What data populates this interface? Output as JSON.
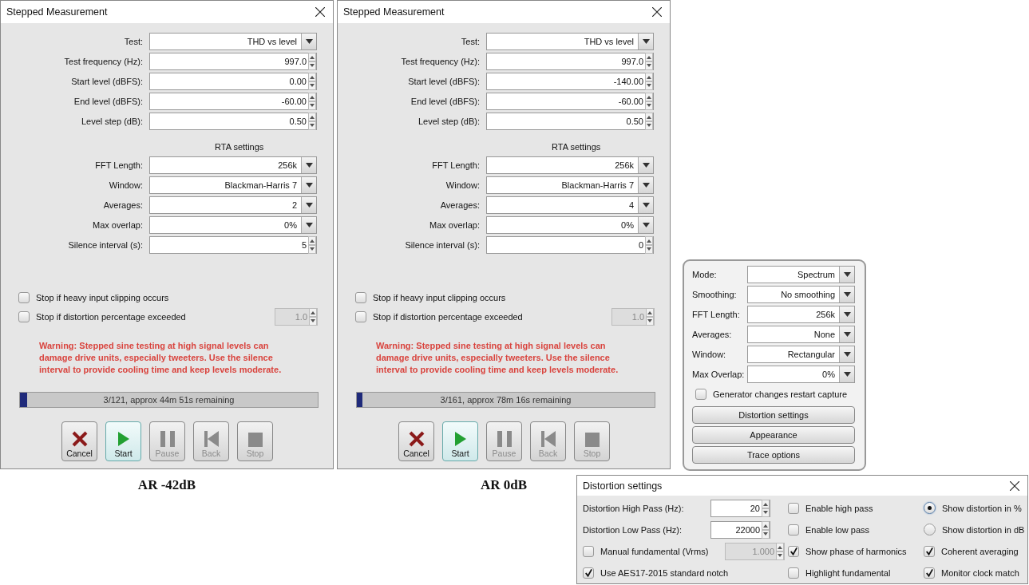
{
  "dialogs": [
    {
      "title": "Stepped Measurement",
      "fields": [
        {
          "label": "Test:",
          "value": "THD vs level",
          "kind": "dropdown"
        },
        {
          "label": "Test frequency (Hz):",
          "value": "997.0",
          "kind": "spin"
        },
        {
          "label": "Start level (dBFS):",
          "value": "0.00",
          "kind": "spin"
        },
        {
          "label": "End level (dBFS):",
          "value": "-60.00",
          "kind": "spin"
        },
        {
          "label": "Level step (dB):",
          "value": "0.50",
          "kind": "spin"
        }
      ],
      "rta_heading": "RTA settings",
      "rta_fields": [
        {
          "label": "FFT Length:",
          "value": "256k",
          "kind": "dropdown"
        },
        {
          "label": "Window:",
          "value": "Blackman-Harris 7",
          "kind": "dropdown"
        },
        {
          "label": "Averages:",
          "value": "2",
          "kind": "dropdown"
        },
        {
          "label": "Max overlap:",
          "value": "0%",
          "kind": "dropdown"
        },
        {
          "label": "Silence interval (s):",
          "value": "5",
          "kind": "spin"
        }
      ],
      "checks": [
        {
          "label": "Stop if heavy input clipping occurs",
          "checked": false
        },
        {
          "label": "Stop if distortion percentage exceeded",
          "checked": false,
          "field": {
            "value": "1.0",
            "disabled": true
          }
        }
      ],
      "warning": "Warning: Stepped sine testing at high signal levels can damage drive units, especially tweeters. Use the silence interval to provide cooling time and keep levels moderate.",
      "progress": {
        "level": 0.025,
        "text": "3/121, approx 44m 51s remaining"
      },
      "buttons": [
        {
          "label": "Cancel",
          "kind": "cancel",
          "disabled": false,
          "focused": false
        },
        {
          "label": "Start",
          "kind": "start",
          "disabled": false,
          "focused": true
        },
        {
          "label": "Pause",
          "kind": "pause",
          "disabled": true,
          "focused": false
        },
        {
          "label": "Back",
          "kind": "back",
          "disabled": true,
          "focused": false
        },
        {
          "label": "Stop",
          "kind": "stop",
          "disabled": true,
          "focused": false
        }
      ],
      "caption": "AR -42dB"
    },
    {
      "title": "Stepped Measurement",
      "fields": [
        {
          "label": "Test:",
          "value": "THD vs level",
          "kind": "dropdown"
        },
        {
          "label": "Test frequency (Hz):",
          "value": "997.0",
          "kind": "spin"
        },
        {
          "label": "Start level (dBFS):",
          "value": "-140.00",
          "kind": "spin"
        },
        {
          "label": "End level (dBFS):",
          "value": "-60.00",
          "kind": "spin"
        },
        {
          "label": "Level step (dB):",
          "value": "0.50",
          "kind": "spin"
        }
      ],
      "rta_heading": "RTA settings",
      "rta_fields": [
        {
          "label": "FFT Length:",
          "value": "256k",
          "kind": "dropdown"
        },
        {
          "label": "Window:",
          "value": "Blackman-Harris 7",
          "kind": "dropdown"
        },
        {
          "label": "Averages:",
          "value": "4",
          "kind": "dropdown"
        },
        {
          "label": "Max overlap:",
          "value": "0%",
          "kind": "dropdown"
        },
        {
          "label": "Silence interval (s):",
          "value": "0",
          "kind": "spin"
        }
      ],
      "checks": [
        {
          "label": "Stop if heavy input clipping occurs",
          "checked": false
        },
        {
          "label": "Stop if distortion percentage exceeded",
          "checked": false,
          "field": {
            "value": "1.0",
            "disabled": true
          }
        }
      ],
      "warning": "Warning: Stepped sine testing at high signal levels can damage drive units, especially tweeters. Use the silence interval to provide cooling time and keep levels moderate.",
      "progress": {
        "level": 0.02,
        "text": "3/161, approx 78m 16s remaining"
      },
      "buttons": [
        {
          "label": "Cancel",
          "kind": "cancel",
          "disabled": false,
          "focused": false
        },
        {
          "label": "Start",
          "kind": "start",
          "disabled": false,
          "focused": true
        },
        {
          "label": "Pause",
          "kind": "pause",
          "disabled": true,
          "focused": false
        },
        {
          "label": "Back",
          "kind": "back",
          "disabled": true,
          "focused": false
        },
        {
          "label": "Stop",
          "kind": "stop",
          "disabled": true,
          "focused": false
        }
      ],
      "caption": "AR 0dB"
    }
  ],
  "panel": {
    "fields": [
      {
        "label": "Mode:",
        "value": "Spectrum"
      },
      {
        "label": "Smoothing:",
        "value": "No  smoothing"
      },
      {
        "label": "FFT Length:",
        "value": "256k"
      },
      {
        "label": "Averages:",
        "value": "None"
      },
      {
        "label": "Window:",
        "value": "Rectangular"
      },
      {
        "label": "Max Overlap:",
        "value": "0%"
      }
    ],
    "check": {
      "label": "Generator changes restart capture",
      "checked": false
    },
    "buttons": [
      "Distortion settings",
      "Appearance",
      "Trace options"
    ]
  },
  "distortion": {
    "title": "Distortion settings",
    "cells": [
      {
        "kind": "spin_field",
        "label": "Distortion High Pass (Hz):",
        "value": "20",
        "disabled": false
      },
      {
        "kind": "checkbox",
        "label": "Enable high pass",
        "checked": false
      },
      {
        "kind": "radio",
        "label": "Show distortion in %",
        "selected": true
      },
      {
        "kind": "spin_field",
        "label": "Distortion Low Pass (Hz):",
        "value": "22000",
        "disabled": false
      },
      {
        "kind": "checkbox",
        "label": "Enable low pass",
        "checked": false
      },
      {
        "kind": "radio",
        "label": "Show distortion in dB",
        "selected": false
      },
      {
        "kind": "checkbox_field",
        "label": "Manual fundamental (Vrms)",
        "checked": false,
        "value": "1.000",
        "disabled": true
      },
      {
        "kind": "checkbox",
        "label": "Show phase of harmonics",
        "checked": true
      },
      {
        "kind": "checkbox",
        "label": "Coherent averaging",
        "checked": true
      },
      {
        "kind": "checkbox",
        "label": "Use AES17-2015 standard notch",
        "checked": true
      },
      {
        "kind": "checkbox",
        "label": "Highlight fundamental",
        "checked": false
      },
      {
        "kind": "checkbox",
        "label": "Monitor clock match",
        "checked": true
      }
    ]
  }
}
